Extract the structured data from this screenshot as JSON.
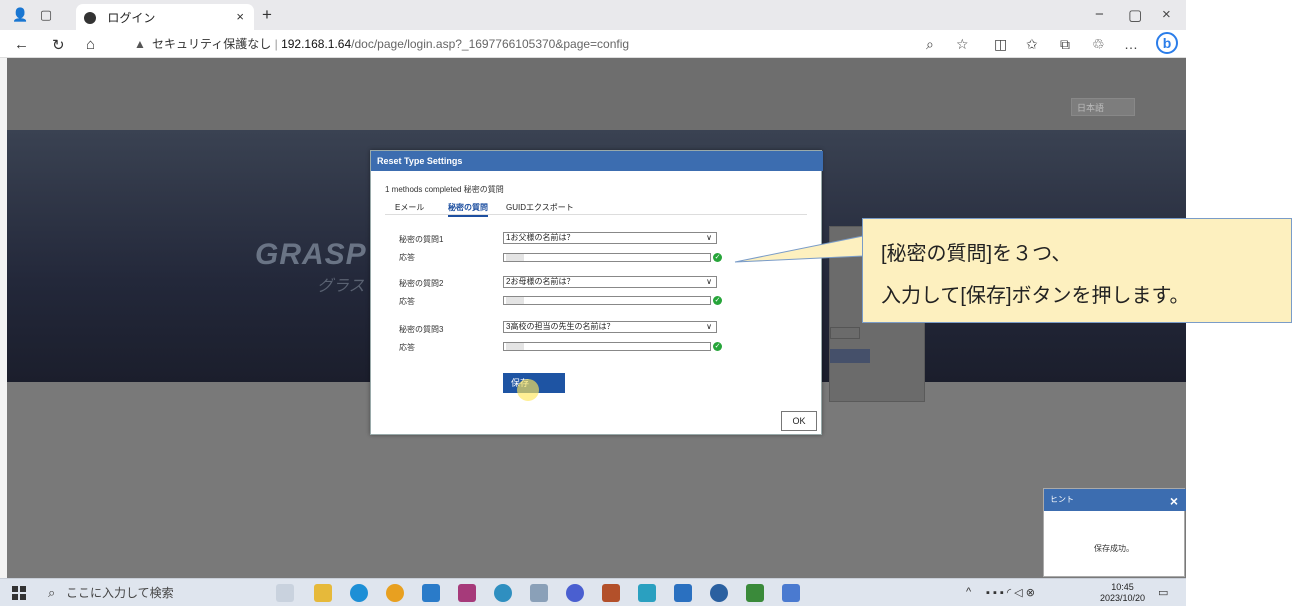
{
  "browser": {
    "tab_title": "ログイン",
    "tab_close": "×",
    "new_tab": "+",
    "security_warning": "セキュリティ保護なし",
    "url_host": "192.168.1.64",
    "url_path": "/doc/page/login.asp?_1697766105370&page=config",
    "window_controls": [
      "−",
      "▢",
      "×"
    ]
  },
  "page": {
    "language_select": "日本語",
    "logo_text": "GRASP",
    "logo_sub": "グラス"
  },
  "dialog": {
    "title": "Reset Type Settings",
    "status": "1 methods completed 秘密の質問",
    "tabs": [
      "Eメール",
      "秘密の質問",
      "GUIDエクスポート"
    ],
    "active_tab": "秘密の質問",
    "questions": [
      {
        "label": "秘密の質問1",
        "answer_label": "応答",
        "value": "1お父様の名前は？"
      },
      {
        "label": "秘密の質問2",
        "answer_label": "応答",
        "value": "2お母様の名前は？"
      },
      {
        "label": "秘密の質問3",
        "answer_label": "応答",
        "value": "3高校の担当の先生の名前は？"
      }
    ],
    "save_label": "保存",
    "ok_label": "OK"
  },
  "callout": {
    "line1": "[秘密の質問]を３つ、",
    "line2": "入力して[保存]ボタンを押します。"
  },
  "hint": {
    "title": "ヒント",
    "close": "×",
    "message": "保存成功。"
  },
  "taskbar": {
    "search_placeholder": "ここに入力して検索",
    "time": "10:45",
    "date": "2023/10/20"
  },
  "colors": {
    "dialog_header": "#3c6db0",
    "save_button": "#1e54a3",
    "callout_bg": "#fdf0bf",
    "check_ok": "#27a53a"
  }
}
